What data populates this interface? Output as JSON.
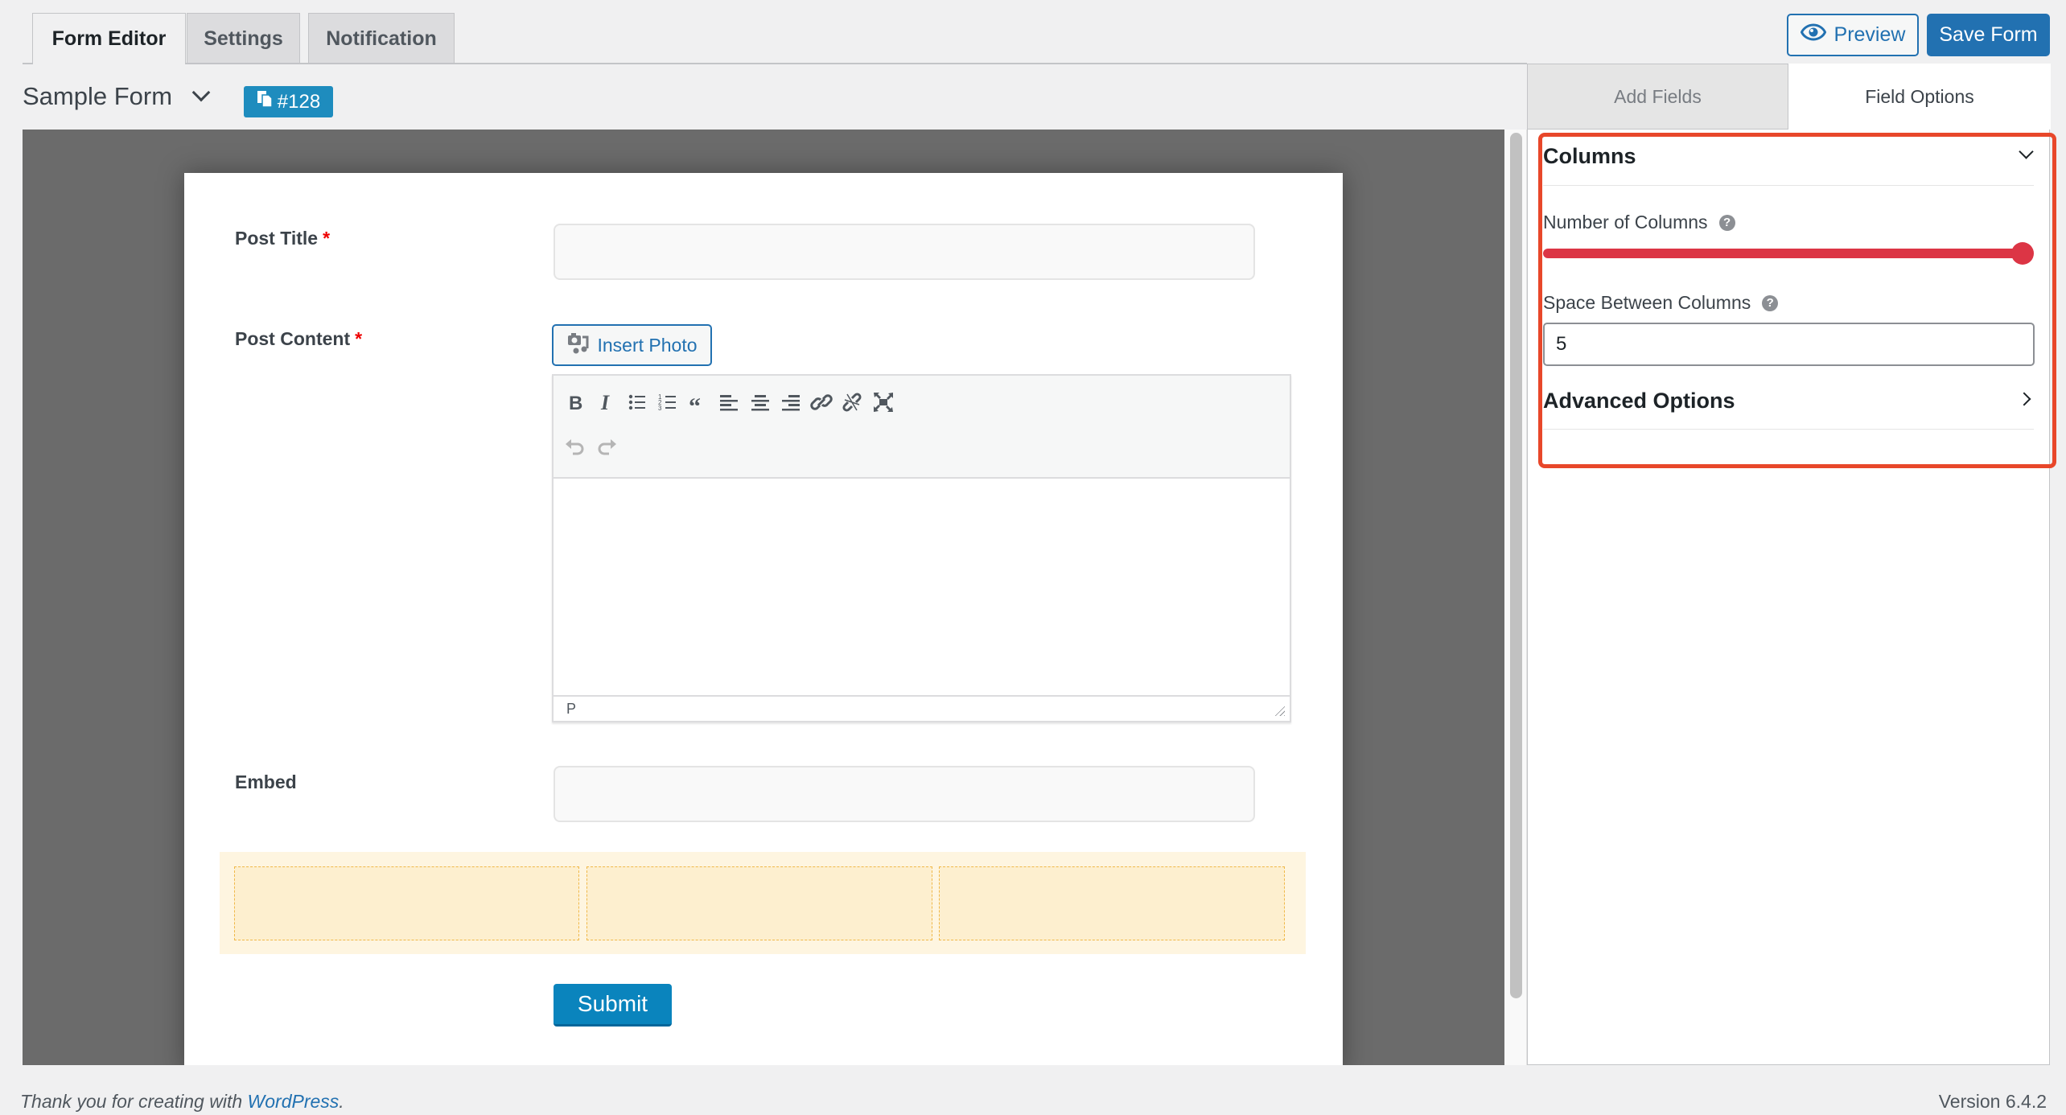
{
  "tabs": [
    {
      "label": "Form Editor",
      "active": true
    },
    {
      "label": "Settings",
      "active": false
    },
    {
      "label": "Notification",
      "active": false
    }
  ],
  "form": {
    "title": "Sample Form",
    "id_badge": "#128"
  },
  "header_buttons": {
    "preview": "Preview",
    "save": "Save Form"
  },
  "fields": {
    "post_title": {
      "label": "Post Title",
      "required_mark": "*",
      "value": ""
    },
    "post_content": {
      "label": "Post Content",
      "required_mark": "*",
      "insert_photo": "Insert Photo",
      "toolbar": [
        "bold",
        "italic",
        "bulleted-list",
        "numbered-list",
        "blockquote",
        "align-left",
        "align-center",
        "align-right",
        "insert-link",
        "remove-link",
        "fullscreen",
        "undo",
        "redo"
      ],
      "status_path": "P"
    },
    "embed": {
      "label": "Embed",
      "value": ""
    },
    "columns": {
      "count": 3
    },
    "submit": "Submit"
  },
  "right_panel": {
    "tabs": [
      {
        "label": "Add Fields",
        "active": false
      },
      {
        "label": "Field Options",
        "active": true
      }
    ],
    "columns_section": {
      "title": "Columns",
      "number_of_columns_label": "Number of Columns",
      "number_of_columns_slider_fraction": 1.0,
      "space_between_label": "Space Between Columns",
      "space_between_value": "5"
    },
    "advanced_section": {
      "title": "Advanced Options"
    },
    "help_glyph": "?",
    "highlight_color": "#e8472a",
    "slider_color": "#dc3545"
  },
  "footer": {
    "thanks_prefix": "Thank you for creating with ",
    "thanks_link": "WordPress",
    "thanks_suffix": ".",
    "version": "Version 6.4.2"
  }
}
